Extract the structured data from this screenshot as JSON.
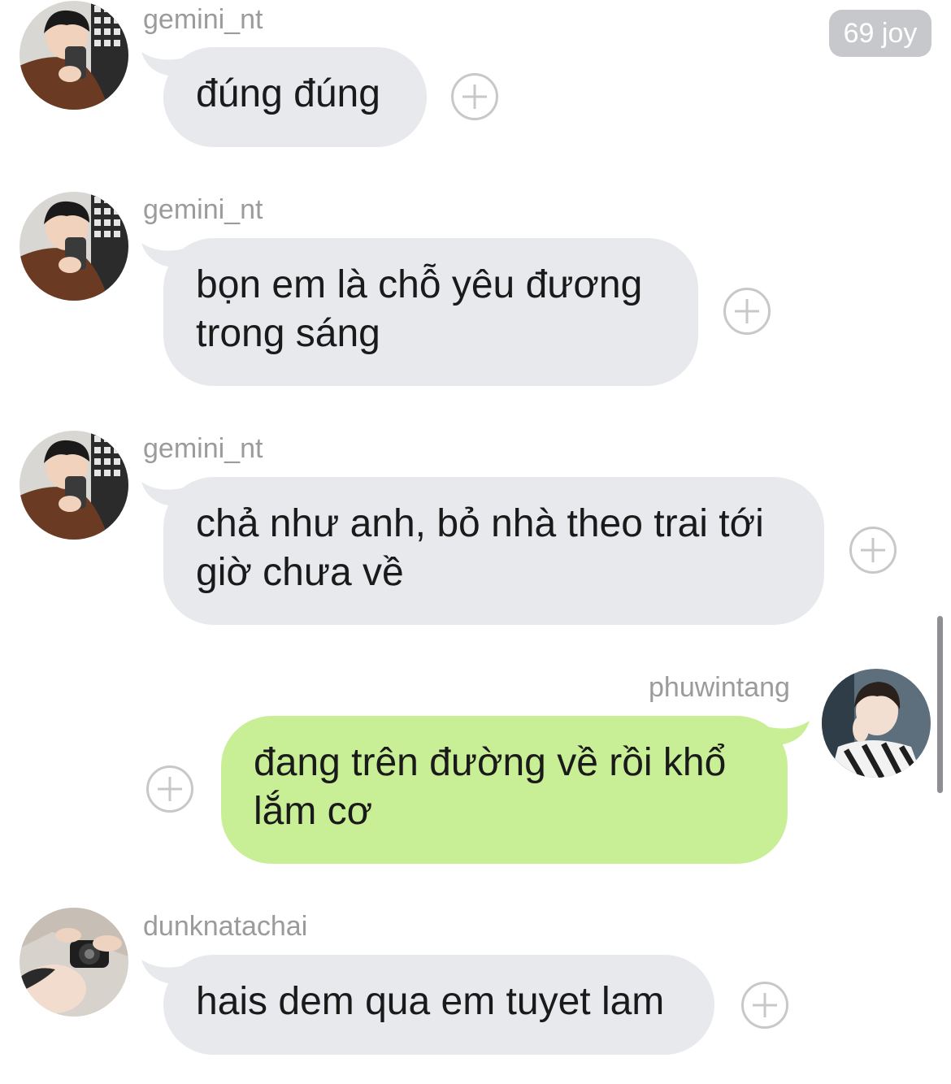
{
  "header": {
    "badge_label": "69 joy"
  },
  "messages": [
    {
      "user": "gemini_nt",
      "text": "đúng đúng",
      "direction": "incoming",
      "avatar_icon": "user-avatar-icon"
    },
    {
      "user": "gemini_nt",
      "text": "bọn em là chỗ yêu đương trong sáng",
      "direction": "incoming",
      "avatar_icon": "user-avatar-icon"
    },
    {
      "user": "gemini_nt",
      "text": "chả như anh, bỏ nhà theo trai tới giờ chưa về",
      "direction": "incoming",
      "avatar_icon": "user-avatar-icon"
    },
    {
      "user": "phuwintang",
      "text": "đang trên đường về rồi khổ lắm cơ",
      "direction": "outgoing",
      "avatar_icon": "user-avatar-icon"
    },
    {
      "user": "dunknatachai",
      "text": "hais dem qua em tuyet lam",
      "direction": "incoming",
      "avatar_icon": "user-avatar-icon"
    }
  ],
  "colors": {
    "incoming_bubble": "#e7e9ec",
    "outgoing_bubble": "#c9ef96",
    "username": "#9b9b9b",
    "badge_bg": "#c7c8cb"
  }
}
